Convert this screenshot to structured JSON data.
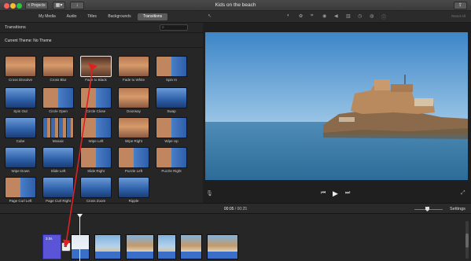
{
  "window": {
    "title": "Kids on the beach",
    "projects_label": "< Projects",
    "view_icon": "view-toggle-icon",
    "import_icon": "import-arrow-icon",
    "share_icon": "share-icon"
  },
  "library_tabs": [
    {
      "label": "My Media",
      "active": false
    },
    {
      "label": "Audio",
      "active": false
    },
    {
      "label": "Titles",
      "active": false
    },
    {
      "label": "Backgrounds",
      "active": false
    },
    {
      "label": "Transitions",
      "active": true
    }
  ],
  "transitions_panel": {
    "title": "Transitions",
    "search_placeholder": "",
    "theme_label": "Current Theme: No Theme"
  },
  "transitions": [
    {
      "label": "Cross Dissolve",
      "style": "warm"
    },
    {
      "label": "Cross Blur",
      "style": "warm"
    },
    {
      "label": "Fade to Black",
      "style": "warm-dark",
      "selected": true
    },
    {
      "label": "Fade to White",
      "style": "warm"
    },
    {
      "label": "Spin In",
      "style": "mix"
    },
    {
      "label": "Spin Out",
      "style": "blue"
    },
    {
      "label": "Circle Open",
      "style": "mix"
    },
    {
      "label": "Circle Close",
      "style": "mix"
    },
    {
      "label": "Doorway",
      "style": "warm"
    },
    {
      "label": "Swap",
      "style": "blue"
    },
    {
      "label": "Cube",
      "style": "blue"
    },
    {
      "label": "Mosaic",
      "style": "mosaic"
    },
    {
      "label": "Wipe Left",
      "style": "mix"
    },
    {
      "label": "Wipe Right",
      "style": "warm"
    },
    {
      "label": "Wipe Up",
      "style": "mix"
    },
    {
      "label": "Wipe Down",
      "style": "blue"
    },
    {
      "label": "Slide Left",
      "style": "blue"
    },
    {
      "label": "Slide Right",
      "style": "mix"
    },
    {
      "label": "Puzzle Left",
      "style": "mix"
    },
    {
      "label": "Puzzle Right",
      "style": "mix"
    },
    {
      "label": "Page Curl Left",
      "style": "mix"
    },
    {
      "label": "Page Curl Right",
      "style": "blue"
    },
    {
      "label": "Cross Zoom",
      "style": "blue"
    },
    {
      "label": "Ripple",
      "style": "blue"
    }
  ],
  "adjust_toolbar": {
    "icons": [
      "magic-wand-icon",
      "color-balance-icon",
      "color-correction-icon",
      "crop-icon",
      "stabilization-icon",
      "volume-icon",
      "noise-reduction-icon",
      "speed-icon",
      "filter-icon",
      "info-icon"
    ],
    "reset_label": "Reset All"
  },
  "viewer": {
    "mic_icon": "microphone-icon",
    "prev_icon": "skip-back-icon",
    "play_icon": "play-icon",
    "next_icon": "skip-forward-icon",
    "fullscreen_icon": "fullscreen-icon"
  },
  "timeline": {
    "current_time": "00:05",
    "separator": " / ",
    "total_time": "00:25",
    "settings_label": "Settings",
    "title_clip_label": "3.0s",
    "zoom_level": 0.4,
    "clips": [
      {
        "kind": "blue-white"
      },
      {
        "kind": "beach"
      },
      {
        "kind": "beach-building"
      },
      {
        "kind": "beach"
      },
      {
        "kind": "beach-building"
      },
      {
        "kind": "beach-building"
      }
    ]
  },
  "colors": {
    "accent_blue": "#3a6fc9",
    "title_clip": "#5a55d6",
    "annotation_arrow": "#e02020"
  }
}
